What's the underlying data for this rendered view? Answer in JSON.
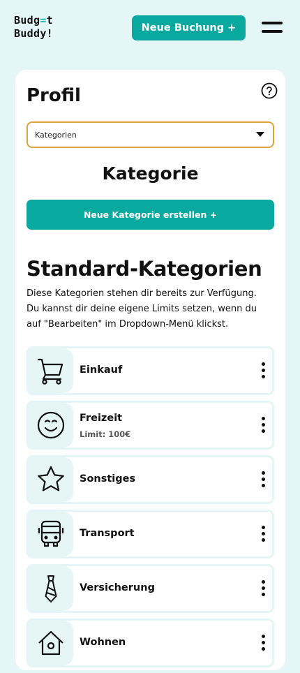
{
  "header": {
    "logo_line1_a": "Budg",
    "logo_line1_accent": "=",
    "logo_line1_b": "t",
    "logo_line2": "Buddy!",
    "new_booking_label": "Neue Buchung +",
    "menu_icon": "hamburger-menu-icon"
  },
  "profile": {
    "title": "Profil",
    "help_icon": "question-circle-icon",
    "select": {
      "value": "Kategorien"
    }
  },
  "category_section": {
    "title": "Kategorie",
    "new_category_label": "Neue Kategorie erstellen +"
  },
  "standard": {
    "title": "Standard-Kategorien",
    "description": "Diese Kategorien stehen dir bereits zur Verfügung. Du kannst dir deine eigene Limits setzen, wenn du auf \"Bearbeiten\" im Dropdown-Menü klickst.",
    "categories": [
      {
        "name": "Einkauf",
        "icon": "shopping-cart-icon",
        "limit": ""
      },
      {
        "name": "Freizeit",
        "icon": "smiley-icon",
        "limit": "Limit: 100€"
      },
      {
        "name": "Sonstiges",
        "icon": "star-icon",
        "limit": ""
      },
      {
        "name": "Transport",
        "icon": "bus-icon",
        "limit": ""
      },
      {
        "name": "Versicherung",
        "icon": "tie-icon",
        "limit": ""
      },
      {
        "name": "Wohnen",
        "icon": "house-icon",
        "limit": ""
      }
    ]
  },
  "colors": {
    "background": "#e4f6f5",
    "accent": "#0aa9a0",
    "select_border": "#e2a03a"
  }
}
